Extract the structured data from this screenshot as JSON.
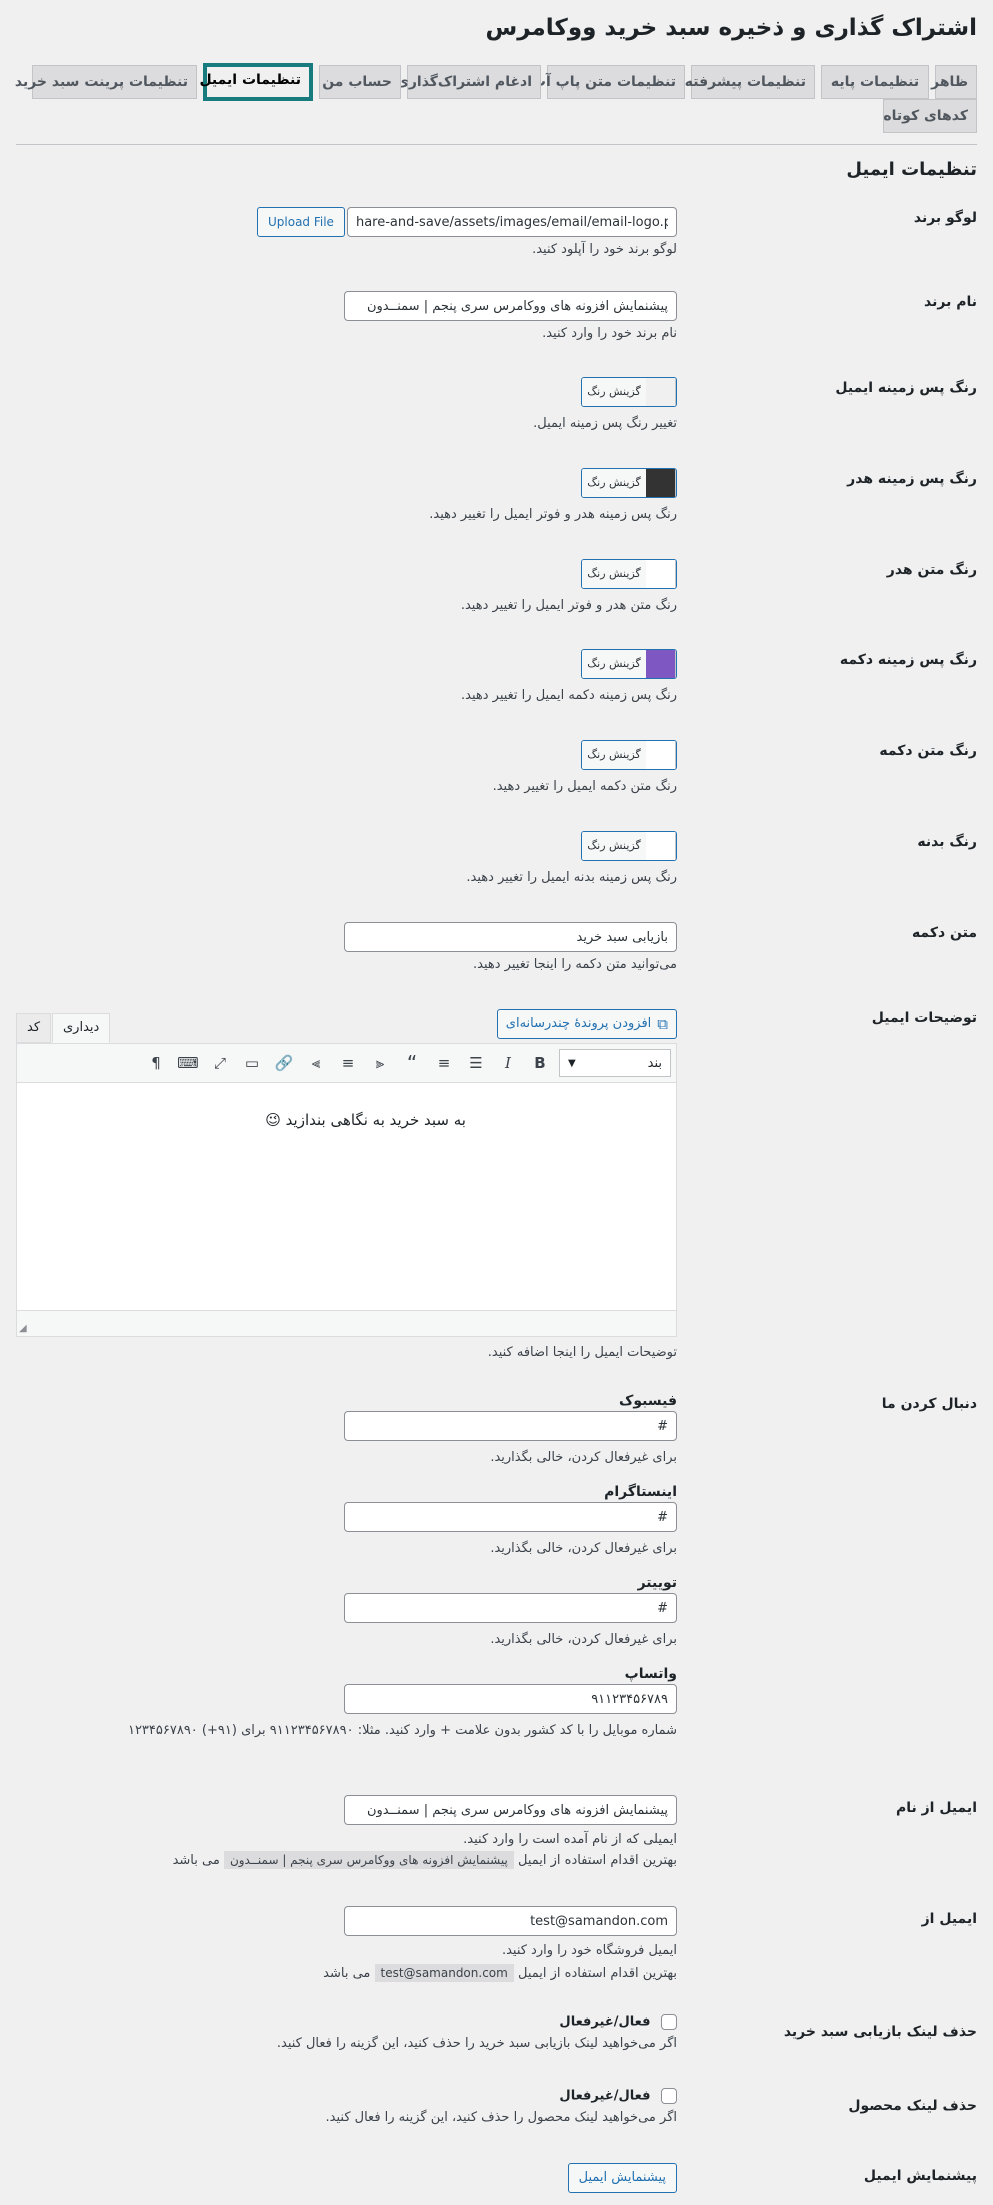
{
  "page": {
    "title": "اشتراک گذاری و ذخیره سبد خرید ووکامرس"
  },
  "tabs": [
    {
      "label": "ظاهر"
    },
    {
      "label": "تنظیمات پایه"
    },
    {
      "label": "تنظیمات پیشرفته"
    },
    {
      "label": "تنظیمات متن پاپ آپ"
    },
    {
      "label": "ادغام اشتراک‌گذاری"
    },
    {
      "label": "حساب من"
    },
    {
      "label": "تنظیمات ایمیل"
    },
    {
      "label": "تنظیمات پرینت سبد خرید"
    },
    {
      "label": "کدهای کوتاه"
    }
  ],
  "section": {
    "title": "تنظیمات ایمیل"
  },
  "logo": {
    "label": "لوگو برند",
    "value": "hare-and-save/assets/images/email/email-logo.png",
    "upload_label": "Upload File",
    "desc": "لوگو برند خود را آپلود کنید."
  },
  "brand_name": {
    "label": "نام برند",
    "value": "پیشنمایش افزونه های ووکامرس سری پنجم | سمنــدون",
    "desc": "نام برند خود را وارد کنید."
  },
  "color_picker_label": "گزینش رنگ",
  "colors": [
    {
      "label": "رنگ پس زمینه ایمیل",
      "swatch": "#f0f0f1",
      "desc": "تغییر رنگ پس زمینه ایمیل."
    },
    {
      "label": "رنگ پس زمینه هدر",
      "swatch": "#333333",
      "desc": "رنگ پس زمینه هدر و فوتر ایمیل را تغییر دهید."
    },
    {
      "label": "رنگ متن هدر",
      "swatch": "#ffffff",
      "desc": "رنگ متن هدر و فوتر ایمیل را تغییر دهید."
    },
    {
      "label": "رنگ پس زمینه دکمه",
      "swatch": "#7e57c2",
      "desc": "رنگ پس زمینه دکمه ایمیل را تغییر دهید."
    },
    {
      "label": "رنگ متن دکمه",
      "swatch": "#ffffff",
      "desc": "رنگ متن دکمه ایمیل را تغییر دهید."
    },
    {
      "label": "رنگ بدنه",
      "swatch": "#ffffff",
      "desc": "رنگ پس زمینه بدنه ایمیل را تغییر دهید."
    }
  ],
  "button_text": {
    "label": "متن دکمه",
    "value": "بازیابی سبد خرید",
    "desc": "می‌توانید متن دکمه را اینجا تغییر دهید."
  },
  "email_desc": {
    "label": "توضیحات ایمیل",
    "add_media": "افزودن پروندهٔ چندرسانه‌ای",
    "tab_visual": "دیداری",
    "tab_code": "کد",
    "format": "بند",
    "content": "به سبد خرید به نگاهی بندازید 😉",
    "desc": "توضیحات ایمیل را اینجا اضافه کنید."
  },
  "follow": {
    "label": "دنبال کردن ما",
    "facebook": {
      "label": "فیسبوک",
      "value": "#",
      "desc": "برای غیرفعال کردن، خالی بگذارید."
    },
    "instagram": {
      "label": "اینستاگرام",
      "value": "#",
      "desc": "برای غیرفعال کردن، خالی بگذارید."
    },
    "twitter": {
      "label": "توییتر",
      "value": "#",
      "desc": "برای غیرفعال کردن، خالی بگذارید."
    },
    "whatsapp": {
      "label": "واتساپ",
      "value": "۹۱۱۲۳۴۵۶۷۸۹",
      "desc": "شماره موبایل را با کد کشور بدون علامت + وارد کنید. مثلا: ۹۱۱۲۳۴۵۶۷۸۹۰ برای (۹۱+) ۱۲۳۴۵۶۷۸۹۰"
    }
  },
  "from_name": {
    "label": "ایمیل از نام",
    "value": "پیشنمایش افزونه های ووکامرس سری پنجم | سمنــدون",
    "desc": "ایمیلی که از نام آمده است را وارد کنید.",
    "best_prefix": "بهترین اقدام استفاده از ایمیل",
    "best_code": "پیشنمایش افزونه های ووکامرس سری پنجم | سمنــدون",
    "best_suffix": "می باشد"
  },
  "from_email": {
    "label": "ایمیل از",
    "value": "test@samandon.com",
    "desc": "ایمیل فروشگاه خود را وارد کنید.",
    "best_prefix": "بهترین اقدام استفاده از ایمیل",
    "best_code": "test@samandon.com",
    "best_suffix": "می باشد"
  },
  "remove_recover": {
    "label": "حذف لینک بازیابی سبد خرید",
    "check_label": "فعال/غیرفعال",
    "desc": "اگر می‌خواهید لینک بازیابی سبد خرید را حذف کنید، این گزینه را فعال کنید."
  },
  "remove_product": {
    "label": "حذف لینک محصول",
    "check_label": "فعال/غیرفعال",
    "desc": "اگر می‌خواهید لینک محصول را حذف کنید، این گزینه را فعال کنید."
  },
  "preview": {
    "label": "پیشنمایش ایمیل",
    "button": "پیشنمایش ایمیل"
  }
}
